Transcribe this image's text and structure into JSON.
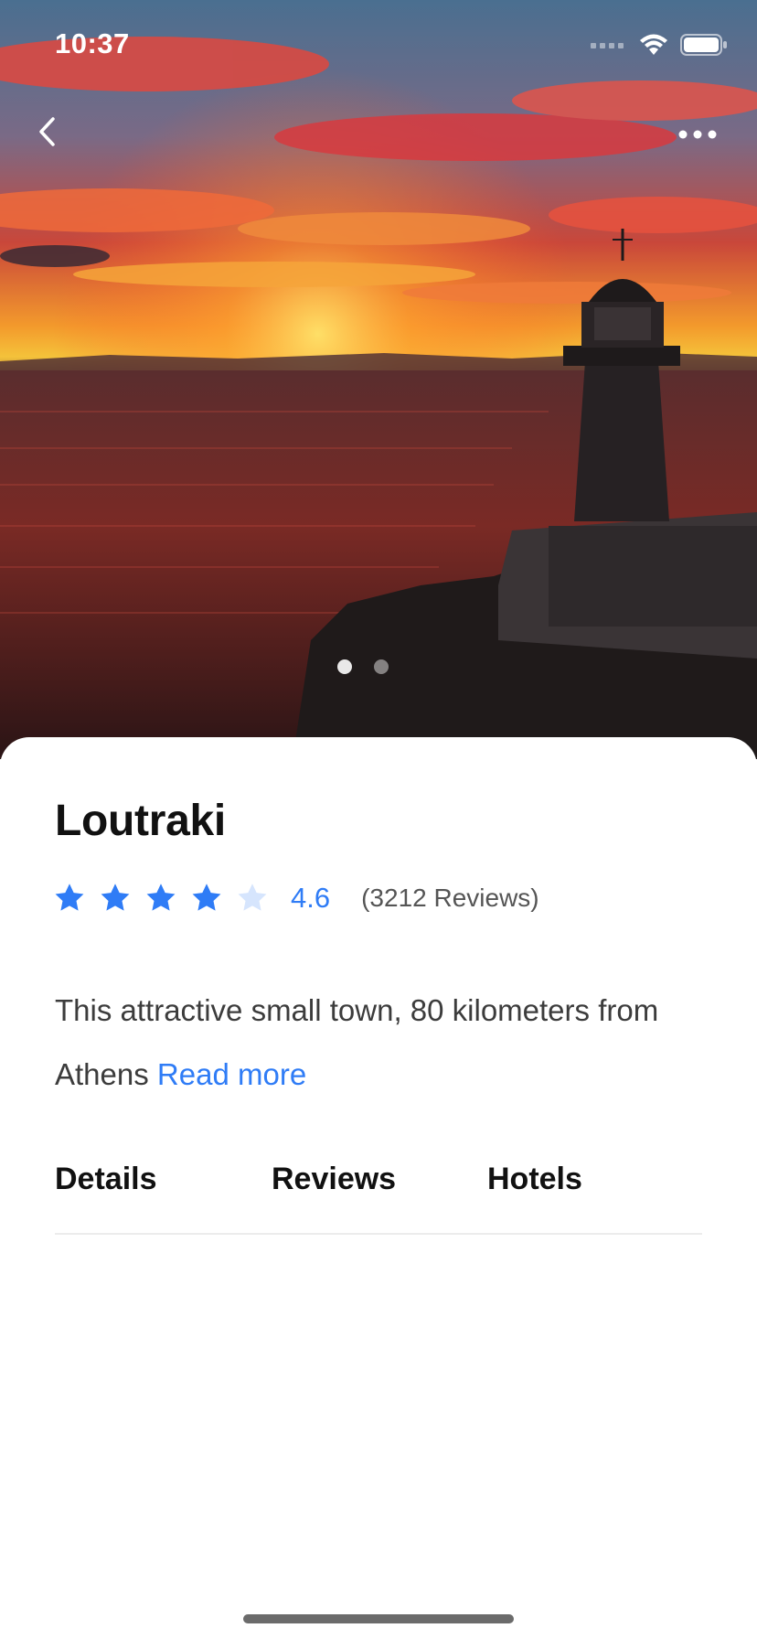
{
  "status_bar": {
    "time": "10:37",
    "icons": [
      "cellular-icon",
      "wifi-icon",
      "battery-icon"
    ]
  },
  "nav": {
    "back_icon": "chevron-left-icon",
    "more_icon": "ellipsis-icon"
  },
  "hero": {
    "image": "sunset-lighthouse-photo",
    "page_count": 2,
    "active_page": 1
  },
  "place": {
    "name": "Loutraki",
    "rating": "4.6",
    "rating_numeric": 4.6,
    "stars_filled": 4,
    "stars_total": 5,
    "review_count": "(3212 Reviews)",
    "description": "This attractive small town, 80 kilometers from Athens",
    "read_more": "Read more"
  },
  "tabs": [
    {
      "label": "Details"
    },
    {
      "label": "Reviews"
    },
    {
      "label": "Hotels"
    }
  ],
  "colors": {
    "accent": "#2f7cf6",
    "star_empty": "#d6e5fd",
    "text_primary": "#111111",
    "text_secondary": "#3c3c3c"
  }
}
